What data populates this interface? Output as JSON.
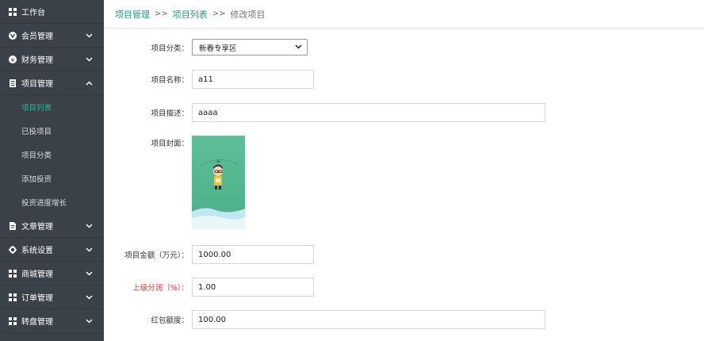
{
  "sidebar": {
    "items": [
      {
        "label": "工作台",
        "icon": "dashboard-icon"
      },
      {
        "label": "会员管理",
        "icon": "member-icon"
      },
      {
        "label": "财务管理",
        "icon": "finance-icon"
      },
      {
        "label": "项目管理",
        "icon": "project-icon",
        "expanded": true,
        "children": [
          {
            "label": "项目列表",
            "active": true
          },
          {
            "label": "已投项目"
          },
          {
            "label": "项目分类"
          },
          {
            "label": "添加投资"
          },
          {
            "label": "投资进度增长"
          }
        ]
      },
      {
        "label": "文章管理",
        "icon": "article-icon"
      },
      {
        "label": "系统设置",
        "icon": "gear-icon"
      },
      {
        "label": "商城管理",
        "icon": "shop-icon"
      },
      {
        "label": "订单管理",
        "icon": "order-icon"
      },
      {
        "label": "转盘管理",
        "icon": "wheel-icon"
      }
    ]
  },
  "breadcrumb": {
    "first": "项目管理",
    "sep": ">>",
    "second": "项目列表",
    "current": "修改项目"
  },
  "form": {
    "category_label": "项目分类：",
    "category_value": "新春专享区",
    "name_label": "项目名称：",
    "name_value": "a11",
    "desc_label": "项目描述：",
    "desc_value": "aaaa",
    "cover_label": "项目封面：",
    "amount_label": "项目金额（万元）：",
    "amount_value": "1000.00",
    "share_label": "上级分润（%）：",
    "share_value": "1.00",
    "redpack_label": "红包额度：",
    "redpack_value": "100.00"
  },
  "colors": {
    "sidebar_bg": "#3b4149",
    "accent": "#2bb39b",
    "warn_label": "#e8322f"
  }
}
